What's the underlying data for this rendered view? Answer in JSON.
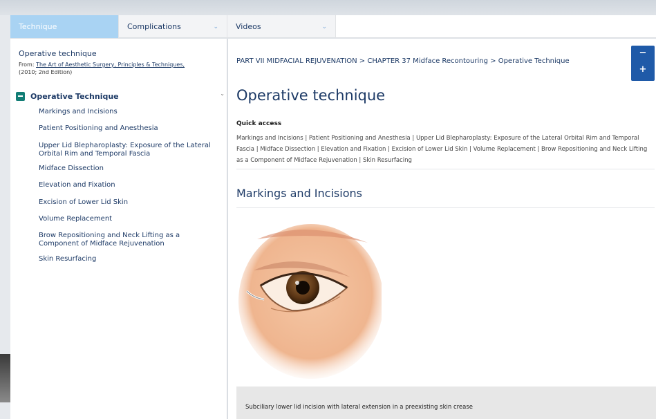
{
  "tabs": [
    {
      "label": "Technique",
      "active": true,
      "has_chevron": false
    },
    {
      "label": "Complications",
      "active": false,
      "has_chevron": true
    },
    {
      "label": "Videos",
      "active": false,
      "has_chevron": true
    }
  ],
  "left_panel": {
    "title": "Operative technique",
    "from_prefix": "From: ",
    "book_title": "The Art of Aesthetic Surgery, Principles & Techniques,",
    "edition": "(2010; 2nd Edition)",
    "toc_heading": "Operative Technique",
    "toc_items": [
      "Markings and Incisions",
      "Patient Positioning and Anesthesia",
      "Upper Lid Blepharoplasty: Exposure of the Lateral Orbital Rim and Temporal Fascia",
      "Midface Dissection",
      "Elevation and Fixation",
      "Excision of Lower Lid Skin",
      "Volume Replacement",
      "Brow Repositioning and Neck Lifting as a Component of Midface Rejuvenation",
      "Skin Resurfacing"
    ]
  },
  "content": {
    "breadcrumb": "PART VII MIDFACIAL REJUVENATION > CHAPTER 37 Midface Recontouring > Operative Technique",
    "heading": "Operative technique",
    "quick_access_label": "Quick access",
    "quick_access_text": "Markings and Incisions | Patient Positioning and Anesthesia | Upper Lid Blepharoplasty: Exposure of the Lateral Orbital Rim and Temporal Fascia | Midface Dissection | Elevation and Fixation | Excision of Lower Lid Skin | Volume Replacement | Brow Repositioning and Neck Lifting as a Component of Midface Rejuvenation | Skin Resurfacing",
    "section_heading": "Markings and Incisions",
    "figure_caption": "Subciliary lower lid incision with lateral extension in a preexisting skin crease",
    "zoom_minus": "−",
    "zoom_plus": "+"
  },
  "colors": {
    "active_tab": "#a9d3f3",
    "link_text": "#1d3a66",
    "toc_toggle": "#127d75",
    "zoom_button": "#1f5aa8",
    "caption_band": "#e7e7e7"
  },
  "icons": {
    "toc_toggle": "minus-square-icon",
    "tab_chevron": "chevron-down-icon",
    "zoom_out": "minus-icon",
    "zoom_in": "plus-icon"
  }
}
